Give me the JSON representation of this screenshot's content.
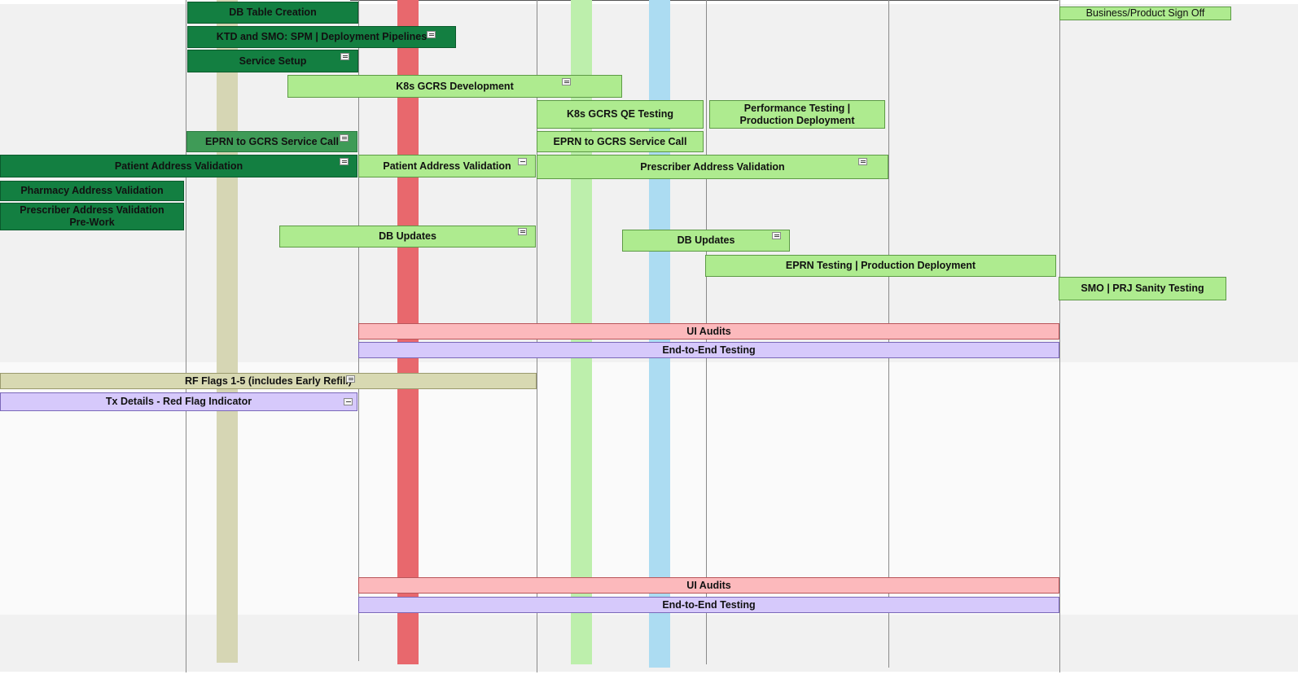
{
  "colors": {
    "dark_green": "#137f41",
    "medium_green": "#3f9b57",
    "light_green": "#aeeb8f",
    "pink": "#fcb9bc",
    "lavender": "#d6c9fb",
    "khaki": "#d8d9b2",
    "stripe_khaki": "#d6d6b4",
    "stripe_red": "#e8686d",
    "stripe_green": "#bdefac",
    "stripe_blue": "#acdcf2"
  },
  "tasks": {
    "db_table_creation": "DB Table Creation",
    "ktd_smo_pipelines": "KTD and SMO: SPM | Deployment Pipelines",
    "service_setup": "Service Setup",
    "k8s_gcrs_development": "K8s GCRS Development",
    "k8s_gcrs_qe_testing": "K8s GCRS QE Testing",
    "performance_testing": "Performance Testing | Production Deployment",
    "eprn_to_gcrs_a": "EPRN to GCRS Service Call",
    "eprn_to_gcrs_b": "EPRN to GCRS Service Call",
    "patient_address_validation_a": "Patient Address Validation",
    "patient_address_validation_b": "Patient Address Validation",
    "prescriber_address_validation": "Prescriber Address Validation",
    "pharmacy_address_validation": "Pharmacy Address Validation",
    "prescriber_prework": "Prescriber Address Validation Pre-Work",
    "db_updates_a": "DB Updates",
    "db_updates_b": "DB Updates",
    "eprn_testing": "EPRN Testing | Production Deployment",
    "business_signoff": "Business/Product Sign Off",
    "smo_prj_sanity": "SMO | PRJ Sanity Testing",
    "ui_audits_a": "UI Audits",
    "e2e_testing_a": "End-to-End Testing",
    "rf_flags": "RF Flags 1-5 (includes Early Refill)",
    "tx_details": "Tx Details - Red Flag Indicator",
    "ui_audits_b": "UI Audits",
    "e2e_testing_b": "End-to-End Testing"
  }
}
